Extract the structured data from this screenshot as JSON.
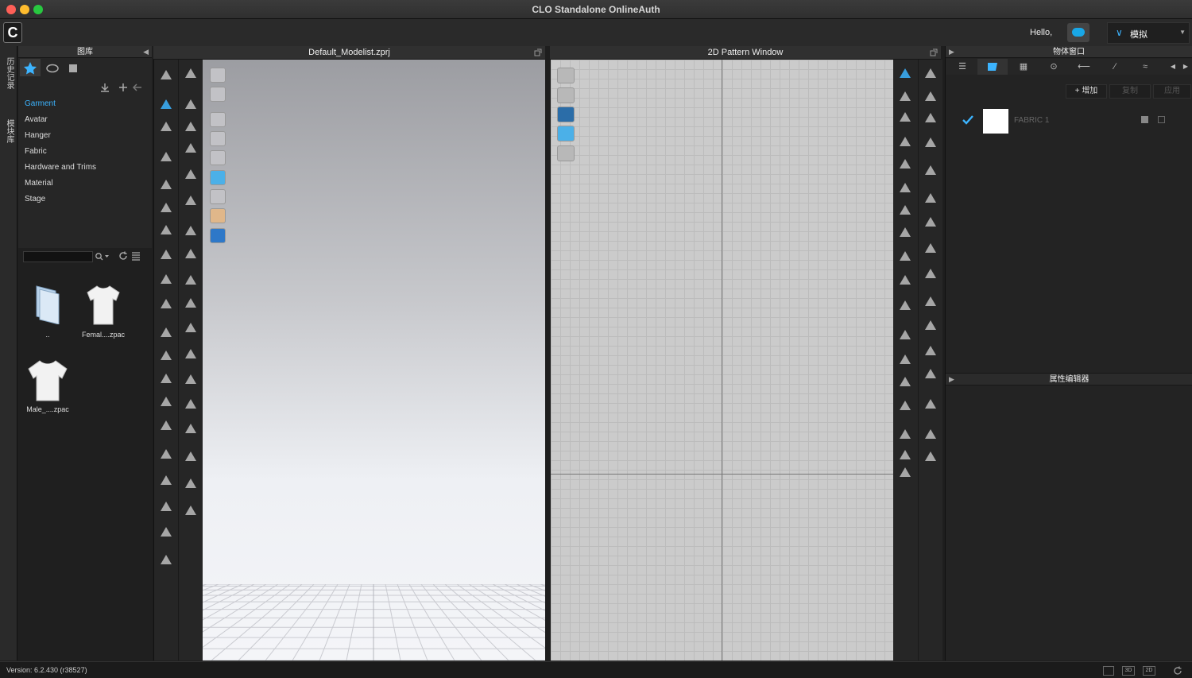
{
  "window": {
    "title": "CLO Standalone OnlineAuth",
    "traffic_lights": [
      "#fe5f57",
      "#febc2e",
      "#28c840"
    ]
  },
  "topbar": {
    "greeting": "Hello,",
    "mode_label": "模拟",
    "accent": "#3cb4ff"
  },
  "left_strip": {
    "history_label": "历史记录",
    "module_label": "模块库"
  },
  "library": {
    "title": "图库",
    "tree": [
      "Garment",
      "Avatar",
      "Hanger",
      "Fabric",
      "Hardware and Trims",
      "Material",
      "Stage"
    ],
    "active_item": "Garment",
    "search_placeholder": "",
    "files": [
      {
        "label": "..",
        "icon": "folder-icon"
      },
      {
        "label": "Femal....zpac",
        "icon": "tshirt-icon"
      },
      {
        "label": "Male_....zpac",
        "icon": "tshirt-icon"
      }
    ]
  },
  "view3d": {
    "title": "Default_Modelist.zprj"
  },
  "view2d": {
    "title": "2D Pattern Window"
  },
  "object_window": {
    "title": "物体窗口",
    "add_label": "增加",
    "copy_label": "复制",
    "apply_label": "应用",
    "fabric_name": "FABRIC 1"
  },
  "property_editor": {
    "title": "属性编辑器"
  },
  "status": {
    "version": "Version: 6.2.430 (r38527)",
    "view_3d": "3D",
    "view_2d": "2D"
  }
}
